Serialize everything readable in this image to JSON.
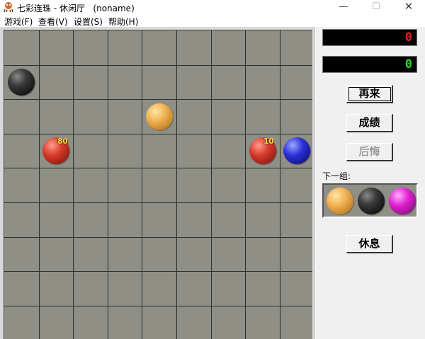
{
  "window": {
    "title": "七彩连珠 - 休闲厅   (noname)",
    "minimize_glyph": "—",
    "maximize_glyph": "☐",
    "close_glyph": "✕",
    "icon": "game-app-icon"
  },
  "menu": {
    "items": [
      "游戏(F)",
      "查看(V)",
      "设置(S)",
      "帮助(H)"
    ]
  },
  "board": {
    "rows": 9,
    "cols": 9,
    "balls": [
      {
        "row": 1,
        "col": 0,
        "color": "black"
      },
      {
        "row": 2,
        "col": 4,
        "color": "orange"
      },
      {
        "row": 3,
        "col": 1,
        "color": "red",
        "badge": "80"
      },
      {
        "row": 3,
        "col": 7,
        "color": "red",
        "badge": "10"
      },
      {
        "row": 3,
        "col": 8,
        "color": "blue"
      }
    ]
  },
  "scores": {
    "top": "0",
    "bottom": "0",
    "top_color": "#e82020",
    "bottom_color": "#20e020"
  },
  "buttons": {
    "restart": "再来",
    "records": "成绩",
    "undo": "后悔",
    "rest": "休息"
  },
  "next_group": {
    "label": "下一组:",
    "balls": [
      "orange",
      "black",
      "magenta"
    ]
  }
}
